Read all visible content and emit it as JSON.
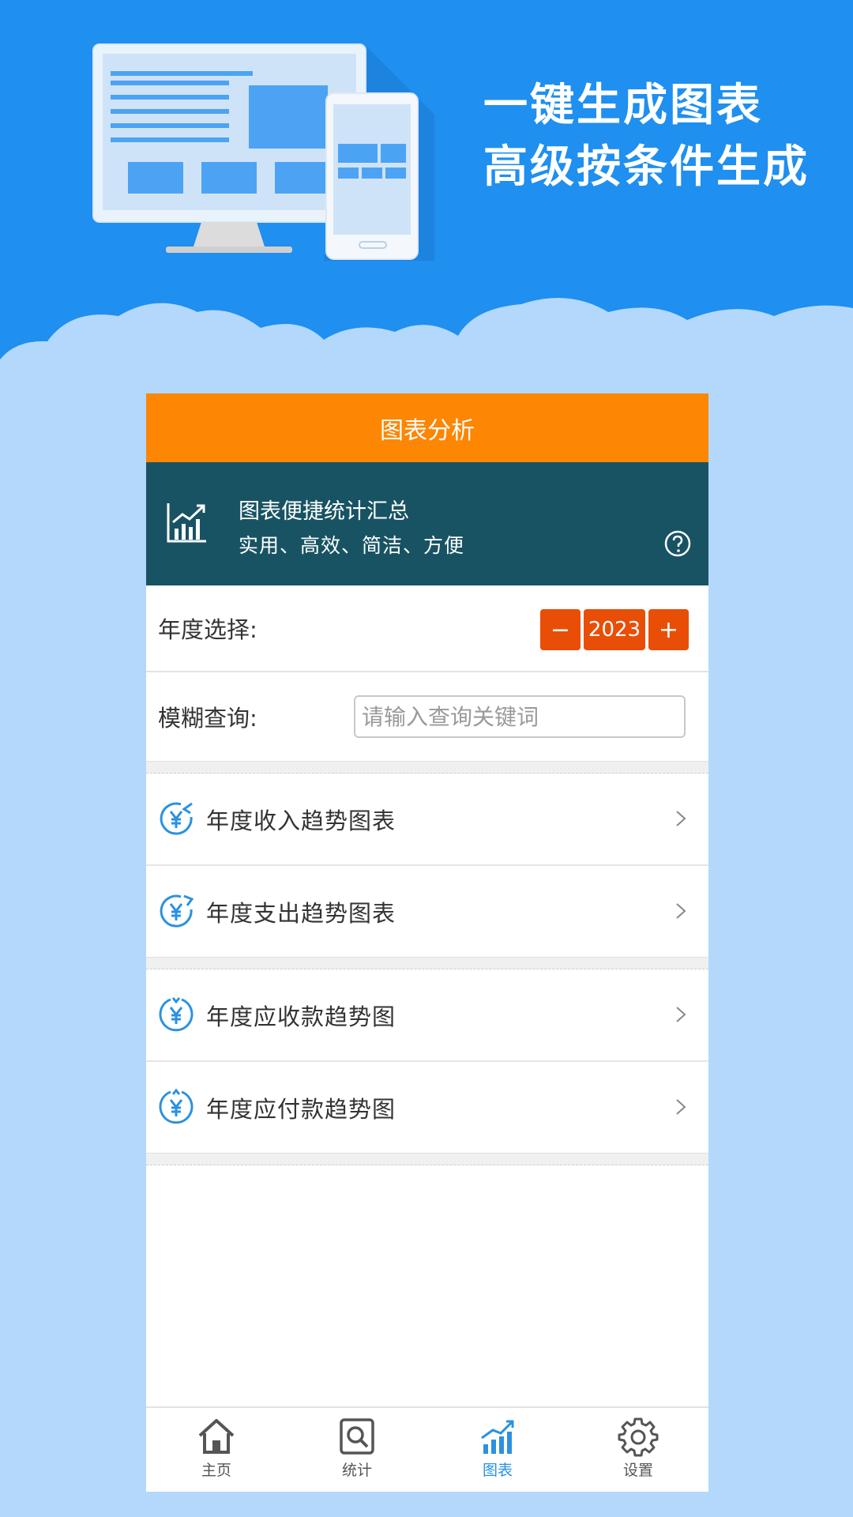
{
  "promo": {
    "line1": "一键生成图表",
    "line2": "高级按条件生成"
  },
  "app": {
    "title": "图表分析",
    "banner": {
      "title": "图表便捷统计汇总",
      "subtitle": "实用、高效、简洁、方便",
      "icon": "chart-growth-icon",
      "help_icon": "help-circle-icon"
    },
    "year_selector": {
      "label": "年度选择:",
      "minus": "−",
      "value": "2023",
      "plus": "+"
    },
    "search": {
      "label": "模糊查询:",
      "placeholder": "请输入查询关键词",
      "value": ""
    },
    "group1": [
      {
        "label": "年度收入趋势图表",
        "icon": "yen-arrow-in-icon"
      },
      {
        "label": "年度支出趋势图表",
        "icon": "yen-arrow-out-icon"
      }
    ],
    "group2": [
      {
        "label": "年度应收款趋势图",
        "icon": "yen-receivable-icon"
      },
      {
        "label": "年度应付款趋势图",
        "icon": "yen-payable-icon"
      }
    ],
    "tabs": [
      {
        "label": "主页",
        "icon": "home-icon",
        "active": false
      },
      {
        "label": "统计",
        "icon": "search-stats-icon",
        "active": false
      },
      {
        "label": "图表",
        "icon": "bar-chart-icon",
        "active": true
      },
      {
        "label": "设置",
        "icon": "gear-icon",
        "active": false
      }
    ],
    "colors": {
      "header": "#fd8603",
      "banner": "#185363",
      "stepper": "#e94e07",
      "accent": "#2b91e0",
      "background": "#1f8ff0"
    }
  }
}
